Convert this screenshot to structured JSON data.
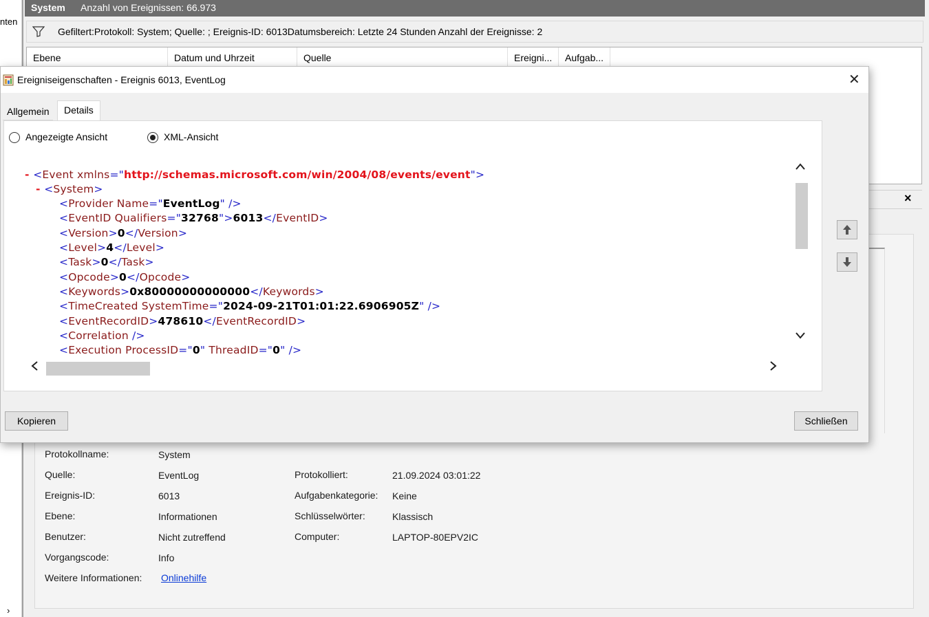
{
  "left": {
    "text": "nten",
    "chevron": "›"
  },
  "topbar": {
    "log": "System",
    "count": "Anzahl von Ereignissen: 66.973"
  },
  "filter": {
    "text": "Gefiltert:Protokoll: System; Quelle: ; Ereignis-ID: 6013Datumsbereich: Letzte 24 Stunden Anzahl der Ereignisse: 2"
  },
  "list": {
    "columns": [
      "Ebene",
      "Datum und Uhrzeit",
      "Quelle",
      "Ereigni...",
      "Aufgab..."
    ]
  },
  "details": {
    "close": "×",
    "fields": {
      "protokollname_label": "Protokollname:",
      "protokollname": "System",
      "quelle_label": "Quelle:",
      "quelle": "EventLog",
      "protokolliert_label": "Protokolliert:",
      "protokolliert": "21.09.2024 03:01:22",
      "ereignisid_label": "Ereignis-ID:",
      "ereignisid": "6013",
      "aufgabe_label": "Aufgabenkategorie:",
      "aufgabe": "Keine",
      "ebene_label": "Ebene:",
      "ebene": "Informationen",
      "schluessel_label": "Schlüsselwörter:",
      "schluessel": "Klassisch",
      "benutzer_label": "Benutzer:",
      "benutzer": "Nicht zutreffend",
      "computer_label": "Computer:",
      "computer": "LAPTOP-80EPV2IC",
      "vorgang_label": "Vorgangscode:",
      "vorgang": "Info",
      "weitere_label": "Weitere Informationen:",
      "weitere": "Onlinehilfe"
    }
  },
  "dialog": {
    "title": "Ereigniseigenschaften - Ereignis 6013, EventLog",
    "close": "✕",
    "tabs": {
      "general": "Allgemein",
      "details": "Details"
    },
    "radio": {
      "friendly": "Angezeigte Ansicht",
      "xml": "XML-Ansicht",
      "selected": "xml"
    },
    "xml": {
      "event_ns": "http://schemas.microsoft.com/win/2004/08/events/event",
      "provider_name": "EventLog",
      "qualifiers": "32768",
      "event_id": "6013",
      "version": "0",
      "level": "4",
      "task": "0",
      "opcode": "0",
      "keywords": "0x80000000000000",
      "system_time": "2024-09-21T01:01:22.6906905Z",
      "record_id": "478610",
      "process_id": "0",
      "thread_id": "0"
    },
    "buttons": {
      "copy": "Kopieren",
      "close": "Schließen"
    }
  }
}
